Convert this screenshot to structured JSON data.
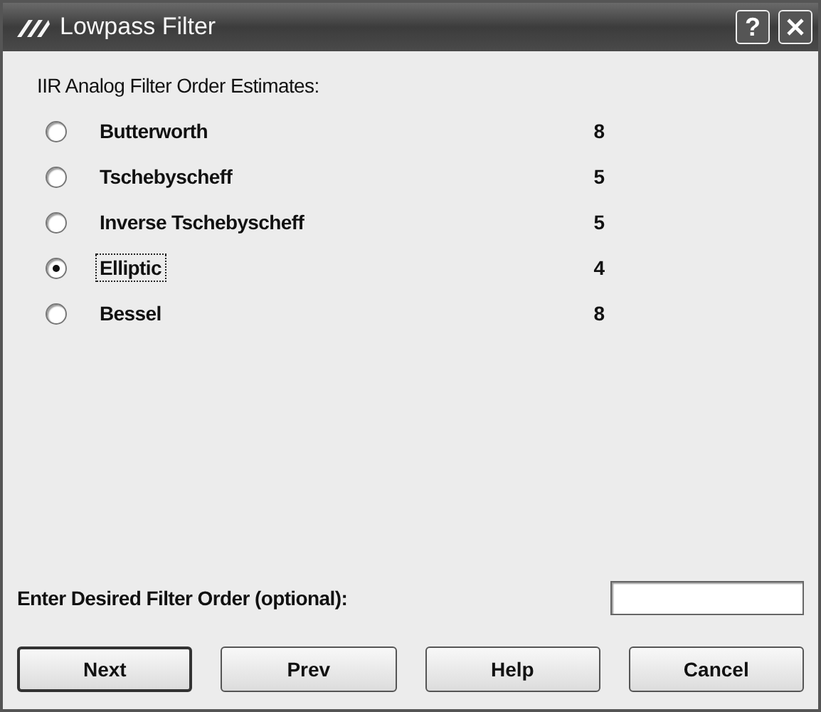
{
  "window": {
    "title": "Lowpass Filter",
    "help_glyph": "?"
  },
  "group": {
    "heading": "IIR Analog Filter Order Estimates:",
    "options": [
      {
        "label": "Butterworth",
        "order": "8",
        "selected": false,
        "focused": false
      },
      {
        "label": "Tschebyscheff",
        "order": "5",
        "selected": false,
        "focused": false
      },
      {
        "label": "Inverse Tschebyscheff",
        "order": "5",
        "selected": false,
        "focused": false
      },
      {
        "label": "Elliptic",
        "order": "4",
        "selected": true,
        "focused": true
      },
      {
        "label": "Bessel",
        "order": "8",
        "selected": false,
        "focused": false
      }
    ]
  },
  "order_field": {
    "label": "Enter Desired Filter Order (optional):"
  },
  "buttons": [
    "Next",
    "Prev",
    "Help",
    "Cancel"
  ]
}
